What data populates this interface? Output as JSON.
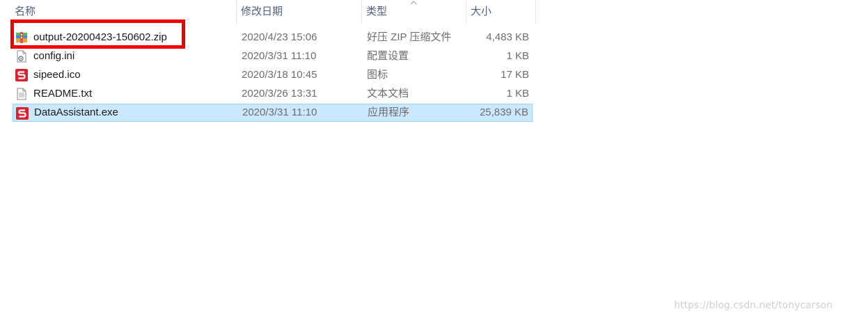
{
  "header": {
    "name": "名称",
    "date": "修改日期",
    "type": "类型",
    "size": "大小"
  },
  "files": [
    {
      "name": "output-20200423-150602.zip",
      "date": "2020/4/23 15:06",
      "type": "好压 ZIP 压缩文件",
      "size": "4,483 KB",
      "icon": "zip-archive-icon",
      "selected": false
    },
    {
      "name": "config.ini",
      "date": "2020/3/31 11:10",
      "type": "配置设置",
      "size": "1 KB",
      "icon": "config-file-icon",
      "selected": false
    },
    {
      "name": "sipeed.ico",
      "date": "2020/3/18 10:45",
      "type": "图标",
      "size": "17 KB",
      "icon": "sipeed-logo-icon",
      "selected": false
    },
    {
      "name": "README.txt",
      "date": "2020/3/26 13:31",
      "type": "文本文档",
      "size": "1 KB",
      "icon": "text-file-icon",
      "selected": false
    },
    {
      "name": "DataAssistant.exe",
      "date": "2020/3/31 11:10",
      "type": "应用程序",
      "size": "25,839 KB",
      "icon": "sipeed-logo-icon",
      "selected": true
    }
  ],
  "watermark": "https://blog.csdn.net/tonycarson",
  "colors": {
    "highlight_box": "#f20000",
    "selection_bg": "#cce8ff",
    "selection_border": "#99d1ff",
    "header_text": "#4d6082"
  }
}
